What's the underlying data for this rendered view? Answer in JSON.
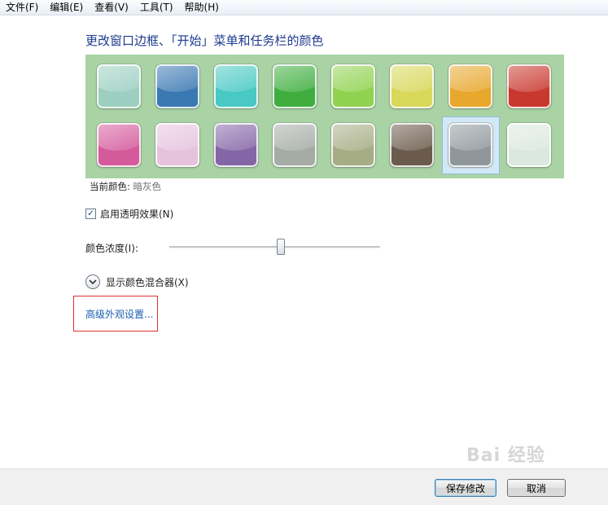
{
  "menubar": {
    "items": [
      "文件(F)",
      "编辑(E)",
      "查看(V)",
      "工具(T)",
      "帮助(H)"
    ]
  },
  "title": "更改窗口边框、「开始」菜单和任务栏的颜色",
  "swatches": {
    "row1": [
      "#9ccfc0",
      "#3a78b2",
      "#48c9c3",
      "#3fae3f",
      "#90d24f",
      "#d8d85a",
      "#e8a72d",
      "#c9382e"
    ],
    "row2": [
      "#d45a9c",
      "#e6c3dd",
      "#8466a6",
      "#a5aca6",
      "#a6ad85",
      "#6b5b4c",
      "#8f979c",
      "#dbe8df"
    ],
    "selected_index": 14
  },
  "current_color": {
    "label": "当前颜色:",
    "value": "暗灰色"
  },
  "transparency": {
    "label": "启用透明效果(N)",
    "checked": true,
    "check_glyph": "✓"
  },
  "intensity": {
    "label": "颜色浓度(I):",
    "value": 0.53
  },
  "mixer": {
    "label": "显示颜色混合器(X)"
  },
  "advanced_link": "高级外观设置...",
  "footer": {
    "save_label": "保存修改",
    "cancel_label": "取消"
  },
  "watermark": {
    "text": "Bai 经验"
  }
}
